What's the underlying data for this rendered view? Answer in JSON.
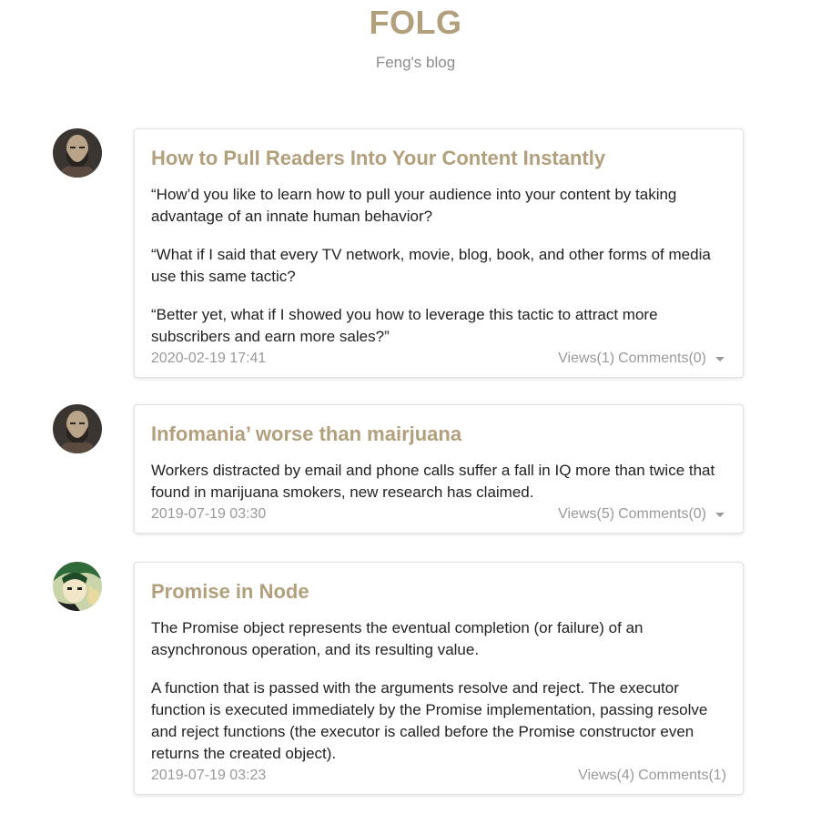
{
  "site": {
    "title": "FOLG",
    "subtitle": "Feng's blog"
  },
  "posts": [
    {
      "avatar_icon": "bald-man-avatar",
      "title": "How to Pull Readers Into Your Content Instantly",
      "paragraphs": [
        "“How’d you like to learn how to pull your audience into your content by taking advantage of an innate human behavior?",
        "“What if I said that every TV network, movie, blog, book, and other forms of media use this same tactic?",
        "“Better yet, what if I showed you how to leverage this tactic to attract more subscribers and earn more sales?”"
      ],
      "date": "2020-02-19 17:41",
      "views": "Views(1)",
      "comments": "Comments(0)",
      "has_menu": true
    },
    {
      "avatar_icon": "bald-man-avatar",
      "title": "Infomania’ worse than mairjuana",
      "paragraphs": [
        "Workers distracted by email and phone calls suffer a fall in IQ more than twice that found in marijuana smokers, new research has claimed."
      ],
      "date": "2019-07-19 03:30",
      "views": "Views(5)",
      "comments": "Comments(0)",
      "has_menu": true
    },
    {
      "avatar_icon": "green-hair-avatar",
      "title": "Promise in Node",
      "paragraphs": [
        "The Promise object represents the eventual completion (or failure) of an asynchronous operation, and its resulting value.",
        "A function that is passed with the arguments resolve and reject. The executor function is executed immediately by the Promise implementation, passing resolve and reject functions (the executor is called before the Promise constructor even returns the created object)."
      ],
      "date": "2019-07-19 03:23",
      "views": "Views(4)",
      "comments": "Comments(1)",
      "has_menu": false
    }
  ],
  "colors": {
    "accent": "#b29f7c",
    "muted": "#999999"
  }
}
